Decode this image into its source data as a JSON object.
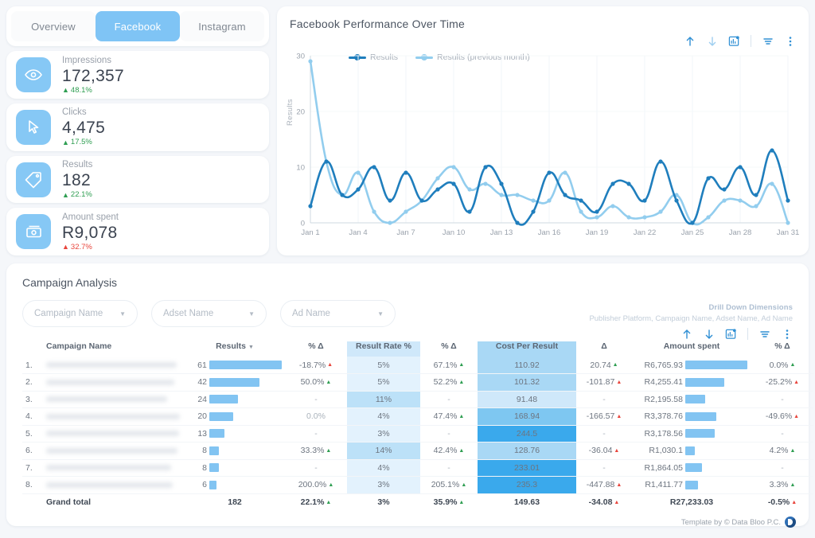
{
  "tabs": [
    {
      "label": "Overview",
      "active": false
    },
    {
      "label": "Facebook",
      "active": true
    },
    {
      "label": "Instagram",
      "active": false
    }
  ],
  "kpis": [
    {
      "icon": "eye-icon",
      "label": "Impressions",
      "value": "172,357",
      "delta": "48.1%",
      "dir": "up"
    },
    {
      "icon": "cursor-icon",
      "label": "Clicks",
      "value": "4,475",
      "delta": "17.5%",
      "dir": "up"
    },
    {
      "icon": "tag-icon",
      "label": "Results",
      "value": "182",
      "delta": "22.1%",
      "dir": "up"
    },
    {
      "icon": "money-icon",
      "label": "Amount spent",
      "value": "R9,078",
      "delta": "32.7%",
      "dir": "down"
    }
  ],
  "chart_panel": {
    "title": "Facebook Performance Over Time",
    "toolbar": [
      "sort-ascending-icon",
      "sort-descending-icon",
      "export-chart-icon",
      "filter-icon",
      "more-options-icon"
    ]
  },
  "chart_data": {
    "type": "line",
    "title": "Facebook Performance Over Time",
    "xlabel": "",
    "ylabel": "Results",
    "ylim": [
      0,
      30
    ],
    "yticks": [
      0,
      10,
      20,
      30
    ],
    "grid": true,
    "legend_position": "top-left",
    "x": [
      "Jan 1",
      "Jan 2",
      "Jan 3",
      "Jan 4",
      "Jan 5",
      "Jan 6",
      "Jan 7",
      "Jan 8",
      "Jan 9",
      "Jan 10",
      "Jan 11",
      "Jan 12",
      "Jan 13",
      "Jan 14",
      "Jan 15",
      "Jan 16",
      "Jan 17",
      "Jan 18",
      "Jan 19",
      "Jan 20",
      "Jan 21",
      "Jan 22",
      "Jan 23",
      "Jan 24",
      "Jan 25",
      "Jan 26",
      "Jan 27",
      "Jan 28",
      "Jan 29",
      "Jan 30",
      "Jan 31"
    ],
    "xtick_labels": [
      "Jan 1",
      "Jan 4",
      "Jan 7",
      "Jan 10",
      "Jan 13",
      "Jan 16",
      "Jan 19",
      "Jan 22",
      "Jan 25",
      "Jan 28",
      "Jan 31"
    ],
    "series": [
      {
        "name": "Results",
        "color": "#1f7ebd",
        "values": [
          3,
          11,
          5,
          6,
          10,
          4,
          9,
          4,
          6,
          7,
          2,
          10,
          7,
          0,
          2,
          9,
          5,
          4,
          2,
          7,
          7,
          4,
          11,
          4,
          0,
          8,
          6,
          10,
          5,
          13,
          4
        ]
      },
      {
        "name": "Results (previous month)",
        "color": "#92cdee",
        "values": [
          29,
          11,
          5,
          9,
          2,
          0,
          2,
          4,
          8,
          10,
          6,
          7,
          5,
          5,
          4,
          4,
          9,
          2,
          1,
          3,
          1,
          1,
          2,
          5,
          0,
          1,
          4,
          4,
          3,
          7,
          0
        ]
      }
    ]
  },
  "campaign_section": {
    "title": "Campaign Analysis",
    "filters": [
      {
        "label": "Campaign Name",
        "icon": "chevron-down-icon"
      },
      {
        "label": "Adset Name",
        "icon": "chevron-down-icon"
      },
      {
        "label": "Ad Name",
        "icon": "chevron-down-icon"
      }
    ],
    "drill_title": "Drill Down Dimensions",
    "drill_sub": "Publisher Platform, Campaign Name, Adset Name, Ad Name",
    "toolbar": [
      "sort-ascending-icon",
      "sort-descending-icon",
      "export-chart-icon",
      "filter-icon",
      "more-options-icon"
    ],
    "columns": [
      "Campaign Name",
      "Results",
      "% Δ",
      "Result Rate %",
      "% Δ",
      "Cost Per Result",
      "Δ",
      "Amount spent",
      "% Δ"
    ],
    "sort_indicator_column": "Results",
    "rows": [
      {
        "idx": "1.",
        "name": "",
        "results": "61",
        "results_bar": 100,
        "pct_d": "-18.7%",
        "pct_d_dir": "down",
        "rate": "5%",
        "rate_level": 1,
        "rate_pct_d": "67.1%",
        "rate_pct_d_dir": "up",
        "cpr": "110.92",
        "cpr_level": 2,
        "cpr_delta": "20.74",
        "cpr_delta_dir": "up",
        "amount": "R6,765.93",
        "amount_bar": 100,
        "amount_pct_d": "0.0%",
        "amount_pct_d_dir": "up"
      },
      {
        "idx": "2.",
        "name": "",
        "results": "42",
        "results_bar": 69,
        "pct_d": "50.0%",
        "pct_d_dir": "up",
        "rate": "5%",
        "rate_level": 1,
        "rate_pct_d": "52.2%",
        "rate_pct_d_dir": "up",
        "cpr": "101.32",
        "cpr_level": 2,
        "cpr_delta": "-101.87",
        "cpr_delta_dir": "down",
        "amount": "R4,255.41",
        "amount_bar": 63,
        "amount_pct_d": "-25.2%",
        "amount_pct_d_dir": "down"
      },
      {
        "idx": "3.",
        "name": "",
        "results": "24",
        "results_bar": 39,
        "pct_d": "-",
        "pct_d_dir": "none",
        "rate": "11%",
        "rate_level": 3,
        "rate_pct_d": "-",
        "rate_pct_d_dir": "none",
        "cpr": "91.48",
        "cpr_level": 1,
        "cpr_delta": "-",
        "cpr_delta_dir": "none",
        "amount": "R2,195.58",
        "amount_bar": 32,
        "amount_pct_d": "-",
        "amount_pct_d_dir": "none"
      },
      {
        "idx": "4.",
        "name": "",
        "results": "20",
        "results_bar": 33,
        "pct_d": "0.0%",
        "pct_d_dir": "none",
        "rate": "4%",
        "rate_level": 1,
        "rate_pct_d": "47.4%",
        "rate_pct_d_dir": "up",
        "cpr": "168.94",
        "cpr_level": 3,
        "cpr_delta": "-166.57",
        "cpr_delta_dir": "down",
        "amount": "R3,378.76",
        "amount_bar": 50,
        "amount_pct_d": "-49.6%",
        "amount_pct_d_dir": "down"
      },
      {
        "idx": "5.",
        "name": "",
        "results": "13",
        "results_bar": 21,
        "pct_d": "-",
        "pct_d_dir": "none",
        "rate": "3%",
        "rate_level": 1,
        "rate_pct_d": "-",
        "rate_pct_d_dir": "none",
        "cpr": "244.5",
        "cpr_level": 4,
        "cpr_delta": "-",
        "cpr_delta_dir": "none",
        "amount": "R3,178.56",
        "amount_bar": 47,
        "amount_pct_d": "-",
        "amount_pct_d_dir": "none"
      },
      {
        "idx": "6.",
        "name": "",
        "results": "8",
        "results_bar": 13,
        "pct_d": "33.3%",
        "pct_d_dir": "up",
        "rate": "14%",
        "rate_level": 3,
        "rate_pct_d": "42.4%",
        "rate_pct_d_dir": "up",
        "cpr": "128.76",
        "cpr_level": 2,
        "cpr_delta": "-36.04",
        "cpr_delta_dir": "down",
        "amount": "R1,030.1",
        "amount_bar": 15,
        "amount_pct_d": "4.2%",
        "amount_pct_d_dir": "up"
      },
      {
        "idx": "7.",
        "name": "",
        "results": "8",
        "results_bar": 13,
        "pct_d": "-",
        "pct_d_dir": "none",
        "rate": "4%",
        "rate_level": 1,
        "rate_pct_d": "-",
        "rate_pct_d_dir": "none",
        "cpr": "233.01",
        "cpr_level": 4,
        "cpr_delta": "-",
        "cpr_delta_dir": "none",
        "amount": "R1,864.05",
        "amount_bar": 27,
        "amount_pct_d": "-",
        "amount_pct_d_dir": "none"
      },
      {
        "idx": "8.",
        "name": "",
        "results": "6",
        "results_bar": 10,
        "pct_d": "200.0%",
        "pct_d_dir": "up",
        "rate": "3%",
        "rate_level": 1,
        "rate_pct_d": "205.1%",
        "rate_pct_d_dir": "up",
        "cpr": "235.3",
        "cpr_level": 4,
        "cpr_delta": "-447.88",
        "cpr_delta_dir": "down",
        "amount": "R1,411.77",
        "amount_bar": 21,
        "amount_pct_d": "3.3%",
        "amount_pct_d_dir": "up"
      }
    ],
    "total": {
      "label": "Grand total",
      "results": "182",
      "pct_d": "22.1%",
      "pct_d_dir": "up",
      "rate": "3%",
      "rate_pct_d": "35.9%",
      "rate_pct_d_dir": "up",
      "cpr": "149.63",
      "cpr_delta": "-34.08",
      "cpr_delta_dir": "down",
      "amount": "R27,233.03",
      "amount_pct_d": "-0.5%",
      "amount_pct_d_dir": "down"
    }
  },
  "footer": {
    "text": "Template by © Data Bloo P.C.",
    "logo": "data-bloo-logo"
  },
  "colors": {
    "accent": "#2f8fd4",
    "series_primary": "#1f7ebd",
    "series_secondary": "#92cdee",
    "bar": "#82c4f2",
    "up": "#2f9e52",
    "down": "#e8453c",
    "tab_active_bg": "#7fc4f5"
  }
}
